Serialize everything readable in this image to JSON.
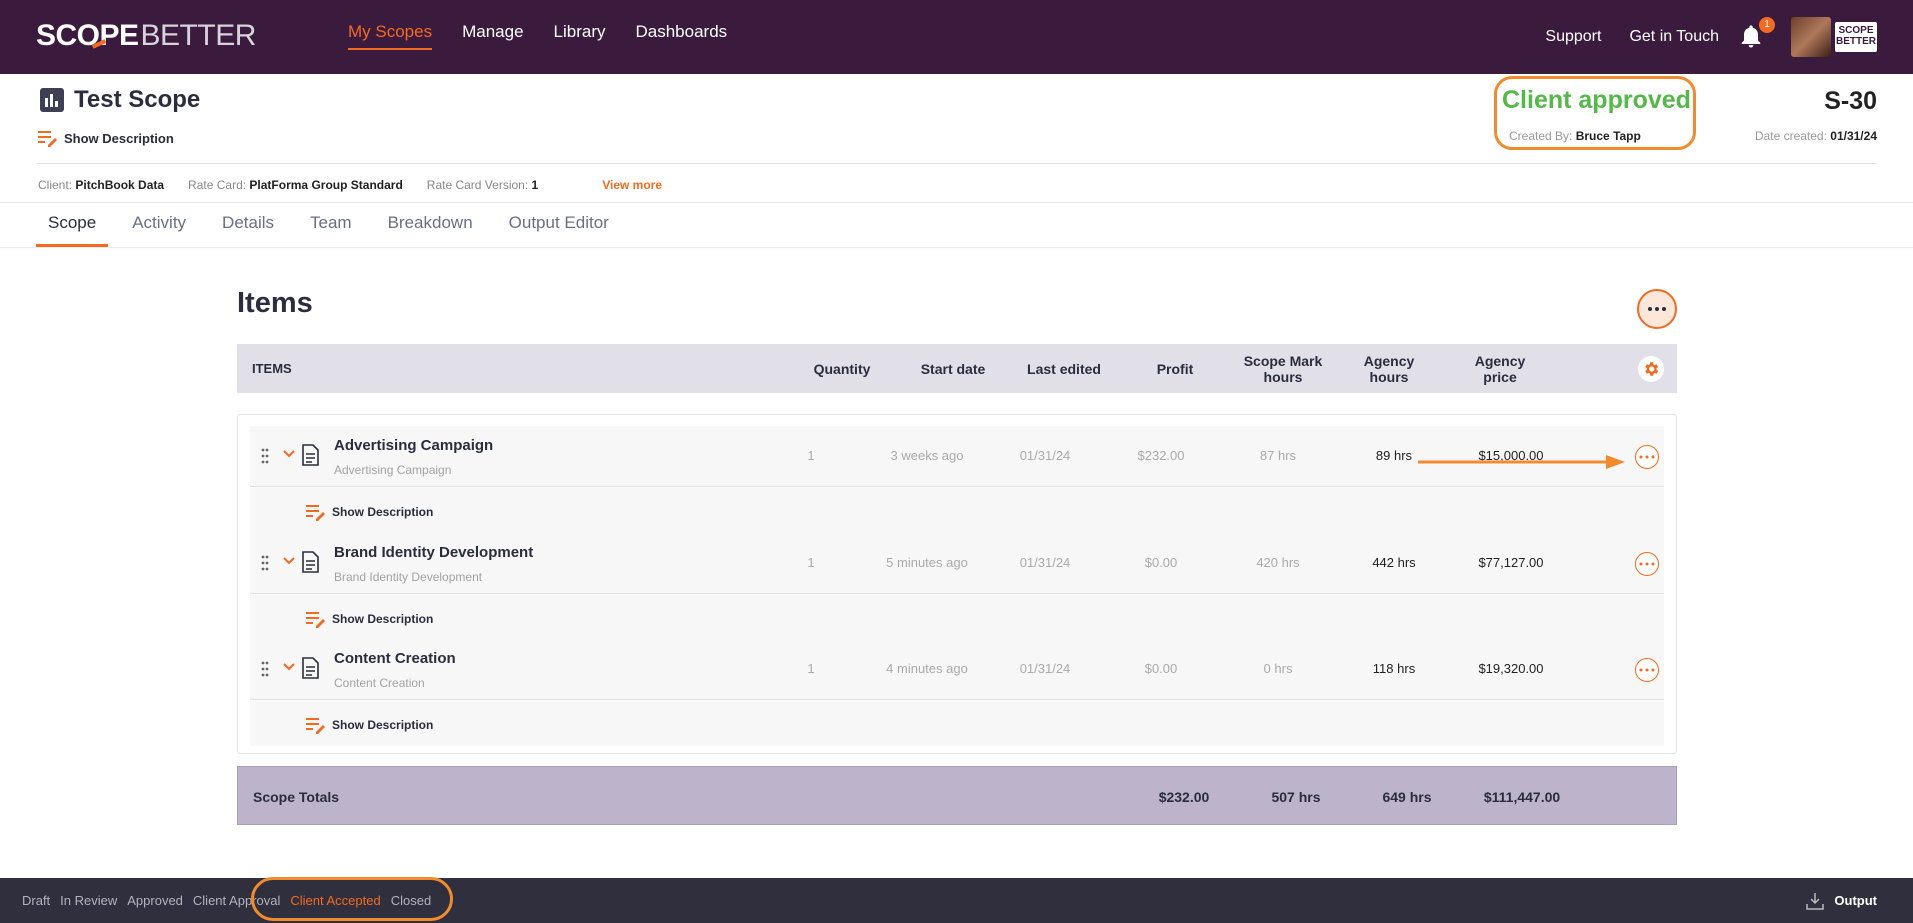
{
  "nav": {
    "logo_left": "SCOPE",
    "logo_right": "BETTER",
    "links": [
      "My Scopes",
      "Manage",
      "Library",
      "Dashboards"
    ],
    "support": "Support",
    "contact": "Get in Touch",
    "notification_count": "1",
    "mini_logo": "SCOPE BETTER"
  },
  "header": {
    "title": "Test Scope",
    "show_description": "Show Description",
    "status": "Client approved",
    "created_by_label": "Created By:",
    "created_by": "Bruce Tapp",
    "scope_id": "S-30",
    "date_created_label": "Date created:",
    "date_created": "01/31/24",
    "client_label": "Client:",
    "client": "PitchBook Data",
    "rate_card_label": "Rate Card:",
    "rate_card": "PlatForma Group Standard",
    "rate_card_version_label": "Rate Card Version:",
    "rate_card_version": "1",
    "view_more": "View more"
  },
  "tabs": [
    "Scope",
    "Activity",
    "Details",
    "Team",
    "Breakdown",
    "Output Editor"
  ],
  "items_title": "Items",
  "table": {
    "headers": {
      "items": "ITEMS",
      "quantity": "Quantity",
      "start_date": "Start date",
      "last_edited": "Last edited",
      "profit": "Profit",
      "scope_mark_hours": "Scope Mark hours",
      "agency_hours": "Agency hours",
      "agency_price": "Agency price"
    },
    "rows": [
      {
        "title": "Advertising Campaign",
        "subtitle": "Advertising Campaign",
        "quantity": "1",
        "start_date": "3 weeks ago",
        "last_edited": "01/31/24",
        "profit": "$232.00",
        "scope_mark_hours": "87 hrs",
        "agency_hours": "89 hrs",
        "agency_price": "$15,000.00",
        "show_description": "Show Description"
      },
      {
        "title": "Brand Identity Development",
        "subtitle": "Brand Identity Development",
        "quantity": "1",
        "start_date": "5 minutes ago",
        "last_edited": "01/31/24",
        "profit": "$0.00",
        "scope_mark_hours": "420 hrs",
        "agency_hours": "442 hrs",
        "agency_price": "$77,127.00",
        "show_description": "Show Description"
      },
      {
        "title": "Content Creation",
        "subtitle": "Content Creation",
        "quantity": "1",
        "start_date": "4 minutes ago",
        "last_edited": "01/31/24",
        "profit": "$0.00",
        "scope_mark_hours": "0 hrs",
        "agency_hours": "118 hrs",
        "agency_price": "$19,320.00",
        "show_description": "Show Description"
      }
    ],
    "totals": {
      "label": "Scope Totals",
      "profit": "$232.00",
      "scope_mark_hours": "507 hrs",
      "agency_hours": "649 hrs",
      "agency_price": "$111,447.00"
    }
  },
  "footer": {
    "stages": [
      "Draft",
      "In Review",
      "Approved",
      "Client Approval",
      "Client Accepted",
      "Closed"
    ],
    "active_stage": "Client Accepted",
    "output": "Output"
  },
  "colors": {
    "nav_bg": "#3a1a3d",
    "accent": "#f26b21",
    "status_green": "#55b84a",
    "highlight": "#f28b2e",
    "totals_bg": "#bdb3ca",
    "footer_bg": "#2f2f3d"
  }
}
